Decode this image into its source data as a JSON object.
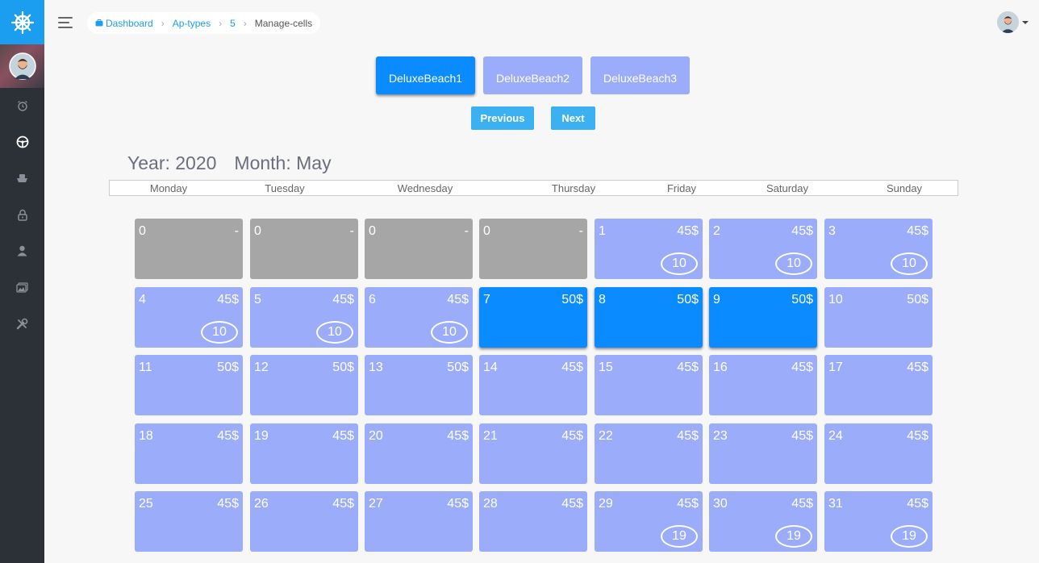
{
  "sidebar": {
    "items": [
      {
        "icon": "alarm-clock-icon"
      },
      {
        "icon": "steering-wheel-icon"
      },
      {
        "icon": "boat-icon"
      },
      {
        "icon": "lock-icon"
      },
      {
        "icon": "user-icon"
      },
      {
        "icon": "images-icon"
      },
      {
        "icon": "tools-icon"
      }
    ]
  },
  "breadcrumb": {
    "dashboard": "Dashboard",
    "ap_types": "Ap-types",
    "id": "5",
    "current": "Manage-cells"
  },
  "room_tabs": [
    "DeluxeBeach1",
    "DeluxeBeach2",
    "DeluxeBeach3"
  ],
  "active_tab": "DeluxeBeach1",
  "nav": {
    "previous": "Previous",
    "next": "Next"
  },
  "calendar": {
    "year_label": "Year: 2020",
    "month_label": "Month: May",
    "weekdays": [
      "Monday",
      "Tuesday",
      "Wednesday",
      "Thursday",
      "Friday",
      "Saturday",
      "Sunday"
    ],
    "cells": [
      {
        "day": "0",
        "price": "-",
        "count": "",
        "state": "empty"
      },
      {
        "day": "0",
        "price": "-",
        "count": "",
        "state": "empty"
      },
      {
        "day": "0",
        "price": "-",
        "count": "",
        "state": "empty"
      },
      {
        "day": "0",
        "price": "-",
        "count": "",
        "state": "empty"
      },
      {
        "day": "1",
        "price": "45$",
        "count": "10",
        "state": "normal"
      },
      {
        "day": "2",
        "price": "45$",
        "count": "10",
        "state": "normal"
      },
      {
        "day": "3",
        "price": "45$",
        "count": "10",
        "state": "normal"
      },
      {
        "day": "4",
        "price": "45$",
        "count": "10",
        "state": "normal"
      },
      {
        "day": "5",
        "price": "45$",
        "count": "10",
        "state": "normal"
      },
      {
        "day": "6",
        "price": "45$",
        "count": "10",
        "state": "normal"
      },
      {
        "day": "7",
        "price": "50$",
        "count": "",
        "state": "selected"
      },
      {
        "day": "8",
        "price": "50$",
        "count": "",
        "state": "selected"
      },
      {
        "day": "9",
        "price": "50$",
        "count": "",
        "state": "selected"
      },
      {
        "day": "10",
        "price": "50$",
        "count": "",
        "state": "normal"
      },
      {
        "day": "11",
        "price": "50$",
        "count": "",
        "state": "normal"
      },
      {
        "day": "12",
        "price": "50$",
        "count": "",
        "state": "normal"
      },
      {
        "day": "13",
        "price": "50$",
        "count": "",
        "state": "normal"
      },
      {
        "day": "14",
        "price": "45$",
        "count": "",
        "state": "normal"
      },
      {
        "day": "15",
        "price": "45$",
        "count": "",
        "state": "normal"
      },
      {
        "day": "16",
        "price": "45$",
        "count": "",
        "state": "normal"
      },
      {
        "day": "17",
        "price": "45$",
        "count": "",
        "state": "normal"
      },
      {
        "day": "18",
        "price": "45$",
        "count": "",
        "state": "normal"
      },
      {
        "day": "19",
        "price": "45$",
        "count": "",
        "state": "normal"
      },
      {
        "day": "20",
        "price": "45$",
        "count": "",
        "state": "normal"
      },
      {
        "day": "21",
        "price": "45$",
        "count": "",
        "state": "normal"
      },
      {
        "day": "22",
        "price": "45$",
        "count": "",
        "state": "normal"
      },
      {
        "day": "23",
        "price": "45$",
        "count": "",
        "state": "normal"
      },
      {
        "day": "24",
        "price": "45$",
        "count": "",
        "state": "normal"
      },
      {
        "day": "25",
        "price": "45$",
        "count": "",
        "state": "normal"
      },
      {
        "day": "26",
        "price": "45$",
        "count": "",
        "state": "normal"
      },
      {
        "day": "27",
        "price": "45$",
        "count": "",
        "state": "normal"
      },
      {
        "day": "28",
        "price": "45$",
        "count": "",
        "state": "normal"
      },
      {
        "day": "29",
        "price": "45$",
        "count": "19",
        "state": "normal"
      },
      {
        "day": "30",
        "price": "45$",
        "count": "19",
        "state": "normal"
      },
      {
        "day": "31",
        "price": "45$",
        "count": "19",
        "state": "normal"
      }
    ]
  },
  "colors": {
    "brand": "#1b9df0",
    "sidebar": "#2b3137",
    "cell_normal": "#9aacfa",
    "cell_selected": "#0a8bff",
    "cell_empty": "#a6a6a6",
    "nav_button": "#3cb1f2"
  }
}
